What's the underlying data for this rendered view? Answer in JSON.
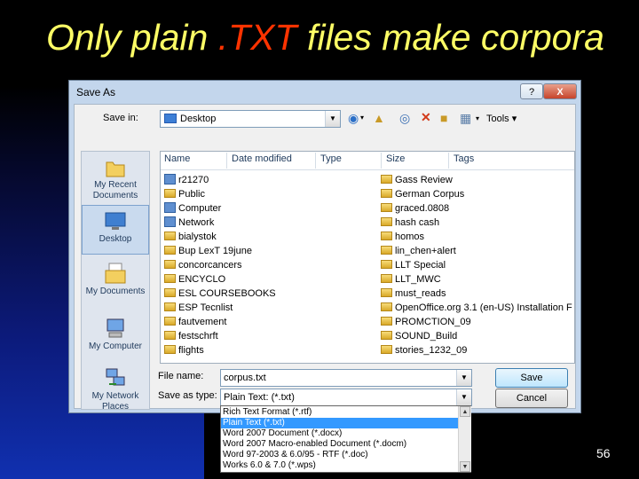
{
  "slide": {
    "title_pre": "Only plain ",
    "title_hl": ".TXT",
    "title_post": " files make corpora",
    "page_number": "56",
    "title_color": "#ffff66",
    "highlight_color": "#ff3300"
  },
  "dialog": {
    "title": "Save As",
    "help_label": "?",
    "close_label": "X",
    "save_in_label": "Save in:",
    "save_in_value": "Desktop",
    "tools_label": "Tools",
    "places": [
      {
        "label": "My Recent Documents",
        "icon": "recent-documents-icon"
      },
      {
        "label": "Desktop",
        "icon": "desktop-icon"
      },
      {
        "label": "My Documents",
        "icon": "my-documents-icon"
      },
      {
        "label": "My Computer",
        "icon": "my-computer-icon"
      },
      {
        "label": "My Network Places",
        "icon": "network-places-icon"
      }
    ],
    "columns": [
      "Name",
      "Date modified",
      "Type",
      "Size",
      "Tags"
    ],
    "files_left": [
      "r21270",
      "Public",
      "Computer",
      "Network",
      "bialystok",
      "Bup LexT 19june",
      "concorcancers",
      "ENCYCLO",
      "ESL COURSEBOOKS",
      "ESP Tecnlist",
      "fautvement",
      "festschrft",
      "flights"
    ],
    "files_right": [
      "Gass Review",
      "German Corpus",
      "graced.0808",
      "hash cash",
      "homos",
      "lin_chen+alert",
      "LLT Special",
      "LLT_MWC",
      "must_reads",
      "OpenOffice.org 3.1 (en-US) Installation F",
      "PROMCTION_09",
      "SOUND_Build",
      "stories_1232_09"
    ],
    "file_name_label": "File name:",
    "file_name_value": "corpus.txt",
    "save_as_type_label": "Save as type:",
    "save_as_type_value": "Plain Text: (*.txt)",
    "save_button": "Save",
    "cancel_button": "Cancel",
    "type_options": [
      "Rich Text Format (*.rtf)",
      "Plain Text (*.txt)",
      "Word 2007 Document (*.docx)",
      "Word 2007 Macro-enabled Document (*.docm)",
      "Word 97-2003 & 6.0/95 - RTF (*.doc)",
      "Works 6.0 & 7.0 (*.wps)"
    ],
    "selected_type_index": 1
  }
}
